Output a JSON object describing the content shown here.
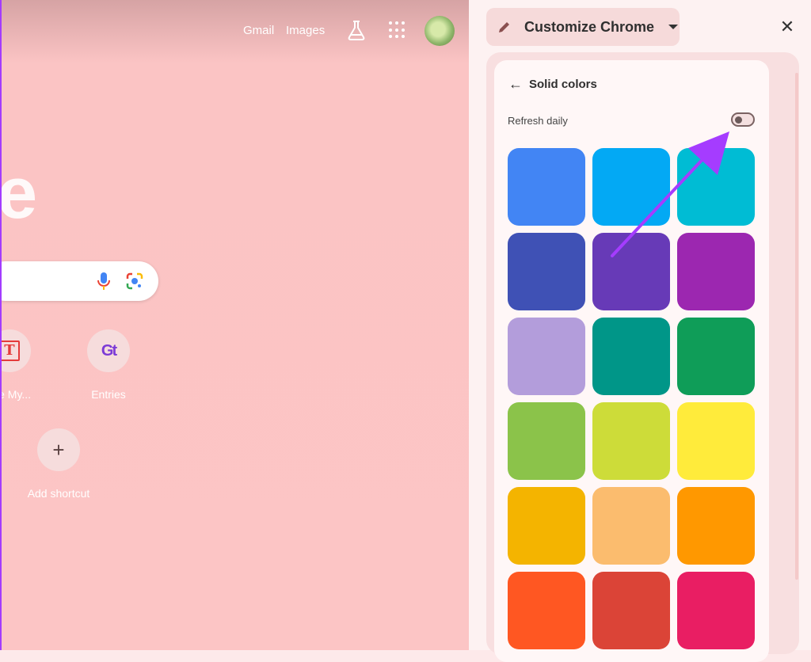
{
  "ntp": {
    "links": {
      "gmail": "Gmail",
      "images": "Images"
    },
    "logo_fragment": "e",
    "shortcuts": [
      {
        "label": "lize My...",
        "icon": "T"
      },
      {
        "label": "Entries",
        "icon": "Gt"
      }
    ],
    "add_shortcut": {
      "label": "Add shortcut",
      "icon": "+"
    }
  },
  "panel": {
    "title": "Customize Chrome",
    "close_label": "✕",
    "back_arrow": "←",
    "section_title": "Solid colors",
    "refresh_label": "Refresh daily",
    "refresh_enabled": false,
    "colors": [
      "#4285f4",
      "#03a9f4",
      "#00bcd4",
      "#3f51b5",
      "#673ab7",
      "#9c27b0",
      "#b39ddb",
      "#009688",
      "#0f9d58",
      "#8bc34a",
      "#cddc39",
      "#ffeb3b",
      "#f4b400",
      "#fbbc6e",
      "#ff9800",
      "#ff5722",
      "#db4437",
      "#e91e63"
    ]
  },
  "annotation": {
    "arrow_color": "#a53cff"
  }
}
